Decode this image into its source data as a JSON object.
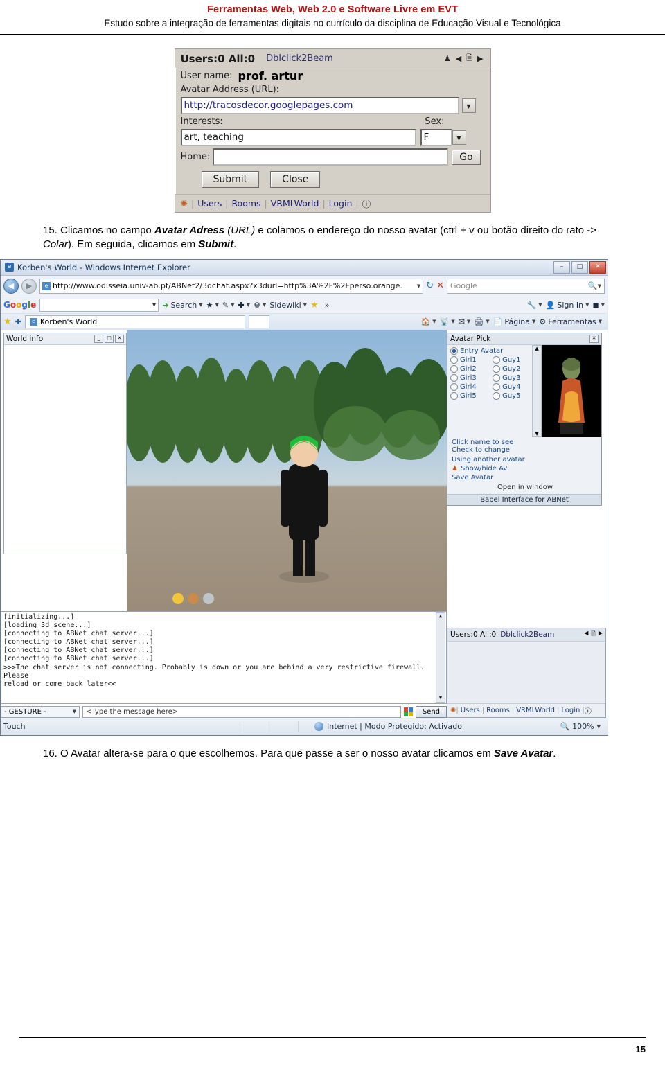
{
  "header": {
    "line1": "Ferramentas Web, Web 2.0 e Software Livre em EVT",
    "line2": "Estudo sobre a integração de ferramentas digitais no currículo da disciplina de Educação Visual e Tecnológica"
  },
  "shot1": {
    "titlebar": {
      "users": "Users:0 All:0",
      "dblclick": "Dblclick2Beam",
      "icons": [
        "person-icon",
        "prev-icon",
        "book-icon",
        "next-icon"
      ]
    },
    "fields": {
      "username_label": "User name:",
      "username_value": "prof. artur",
      "avatar_label": "Avatar Address (URL):",
      "avatar_value": "http://tracosdecor.googlepages.com",
      "interests_label": "Interests:",
      "interests_value": "art, teaching",
      "sex_label": "Sex:",
      "sex_value": "F",
      "home_label": "Home:",
      "home_value": "",
      "go_label": "Go"
    },
    "buttons": {
      "submit": "Submit",
      "close": "Close"
    },
    "footer": [
      "Users",
      "Rooms",
      "VRMLWorld",
      "Login"
    ]
  },
  "step15": {
    "number": "15.",
    "text_a": "Clicamos no campo ",
    "bold_a": "Avatar Adress",
    "italic_a": " (URL)",
    "text_b": " e colamos o endereço do nosso avatar (ctrl + v ou botão direito do rato -> ",
    "italic_b": "Colar",
    "text_c": "). Em seguida, clicamos em ",
    "bold_b": "Submit",
    "text_d": "."
  },
  "browser": {
    "window_title": "Korben's World - Windows Internet Explorer",
    "window_buttons": [
      "minimize",
      "maximize",
      "close"
    ],
    "address_url": "http://www.odisseia.univ-ab.pt/ABNet2/3dchat.aspx?x3durl=http%3A%2F%2Fperso.orange.",
    "search_placeholder": "Google",
    "google_bar": {
      "logo": "Google",
      "search_label": "Search",
      "sidewiki_label": "Sidewiki",
      "signin_label": "Sign In",
      "more_label": "»"
    },
    "command_bar": {
      "page_label": "Página",
      "tools_label": "Ferramentas"
    },
    "tab_label": "Korben's World",
    "world_info": {
      "title": "World info",
      "buttons": [
        "minimize",
        "restore",
        "close"
      ]
    },
    "avatar_pick": {
      "title": "Avatar Pick",
      "close_icon": "close-icon",
      "options": [
        "Entry Avatar",
        "Girl1",
        "Guy1",
        "Girl2",
        "Guy2",
        "Girl3",
        "Guy3",
        "Girl4",
        "Guy4",
        "Girl5",
        "Guy5"
      ],
      "selected": "Entry Avatar",
      "hint1": "Click name to see",
      "hint2": "Check to change",
      "using_another": "Using another avatar",
      "show_hide": "Show/hide Av",
      "save_avatar": "Save Avatar",
      "open_in_window": "Open in window",
      "footer": "Babel Interface for ABNet"
    },
    "chat_log": [
      "[initializing...]",
      "[loading 3d scene...]",
      "[connecting to ABNet chat server...]",
      "[connecting to ABNet chat server...]",
      "[connecting to ABNet chat server...]",
      "[connecting to ABNet chat server...]",
      ">>>The chat server is not connecting. Probably is down or you are behind a very restrictive firewall. Please",
      "reload or come back later<<"
    ],
    "gesture_label": "- GESTURE -",
    "message_placeholder": "<Type the message here>",
    "send_label": "Send",
    "mini_panel": {
      "users": "Users:0 All:0",
      "dblclick": "Dblclick2Beam",
      "links": [
        "Users",
        "Rooms",
        "VRMLWorld",
        "Login"
      ]
    },
    "status": {
      "touch": "Touch",
      "zone": "Internet | Modo Protegido: Activado",
      "zoom": "100%"
    }
  },
  "step16": {
    "number": "16.",
    "text_a": "O Avatar altera-se para o que escolhemos. Para que passe a ser o nosso avatar clicamos em ",
    "bold_a": "Save Avatar",
    "text_b": "."
  },
  "page_number": "15"
}
